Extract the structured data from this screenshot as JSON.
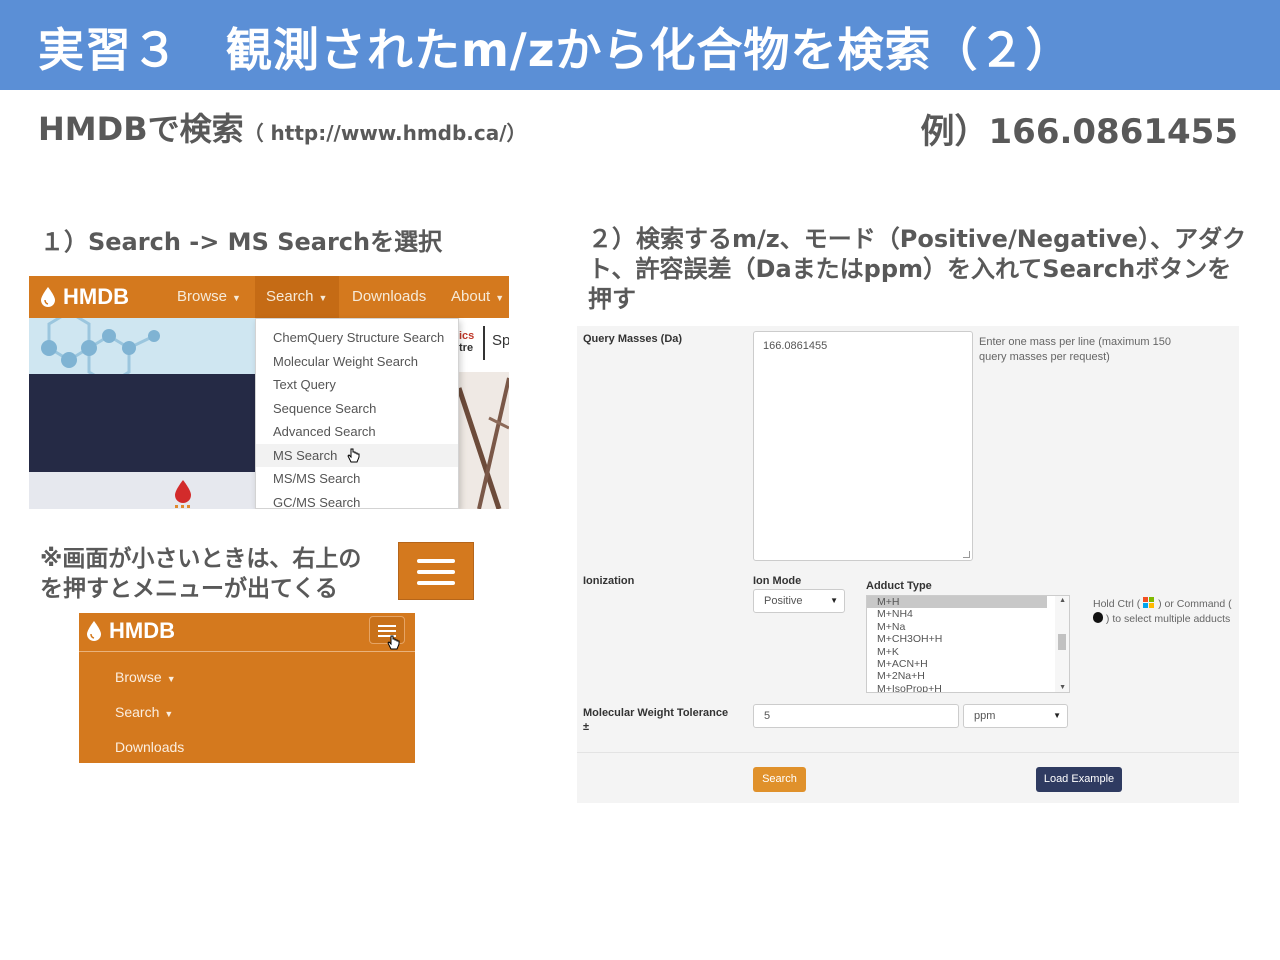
{
  "slide": {
    "title": "実習３　観測されたm/zから化合物を検索（２）",
    "subtitle_main": "HMDBで検索",
    "subtitle_url": "（ http://www.hmdb.ca/）",
    "example": "例）166.0861455",
    "step1": "１）Search -> MS Searchを選択",
    "step2": "２）検索するm/z、モード（Positive/Negative）、アダクト、許容誤差（Daまたはppm）を入れてSearchボタンを押す",
    "note_line1": "※画面が小さいときは、右上の",
    "note_line2": "を押すとメニューが出てくる"
  },
  "nav": {
    "logo": "HMDB",
    "items": [
      "Browse",
      "Search",
      "Downloads",
      "About"
    ],
    "partial_text_1": "ics",
    "partial_text_2": "tre",
    "partial_text_3": "Sp"
  },
  "search_dropdown": {
    "items": [
      "ChemQuery Structure Search",
      "Molecular Weight Search",
      "Text Query",
      "Sequence Search",
      "Advanced Search",
      "MS Search",
      "MS/MS Search",
      "GC/MS Search"
    ],
    "active": "MS Search"
  },
  "mobile_menu": {
    "logo": "HMDB",
    "items": [
      "Browse",
      "Search",
      "Downloads"
    ]
  },
  "ms_form": {
    "query_label": "Query Masses (Da)",
    "query_value": "166.0861455",
    "query_help_1": "Enter one mass per line (maximum 150",
    "query_help_2": "query masses per request)",
    "ionization_label": "Ionization",
    "ion_mode_label": "Ion Mode",
    "ion_mode_value": "Positive",
    "adduct_label": "Adduct Type",
    "adducts": [
      "M+H",
      "M+NH4",
      "M+Na",
      "M+CH3OH+H",
      "M+K",
      "M+ACN+H",
      "M+2Na+H",
      "M+IsoProp+H"
    ],
    "adduct_selected": "M+H",
    "adduct_help_1a": "Hold Ctrl (",
    "adduct_help_1b": ") or Command (",
    "adduct_help_2": ") to select multiple adducts",
    "tolerance_label_1": "Molecular Weight Tolerance",
    "tolerance_label_2": "±",
    "tolerance_value": "5",
    "tolerance_unit": "ppm",
    "search_button": "Search",
    "load_example_button": "Load Example"
  },
  "colors": {
    "title_bar": "#5b8fd6",
    "hmdb_orange": "#d4791e",
    "search_button": "#e0912b",
    "load_example_button": "#2f3b61",
    "body_text": "#595959"
  }
}
